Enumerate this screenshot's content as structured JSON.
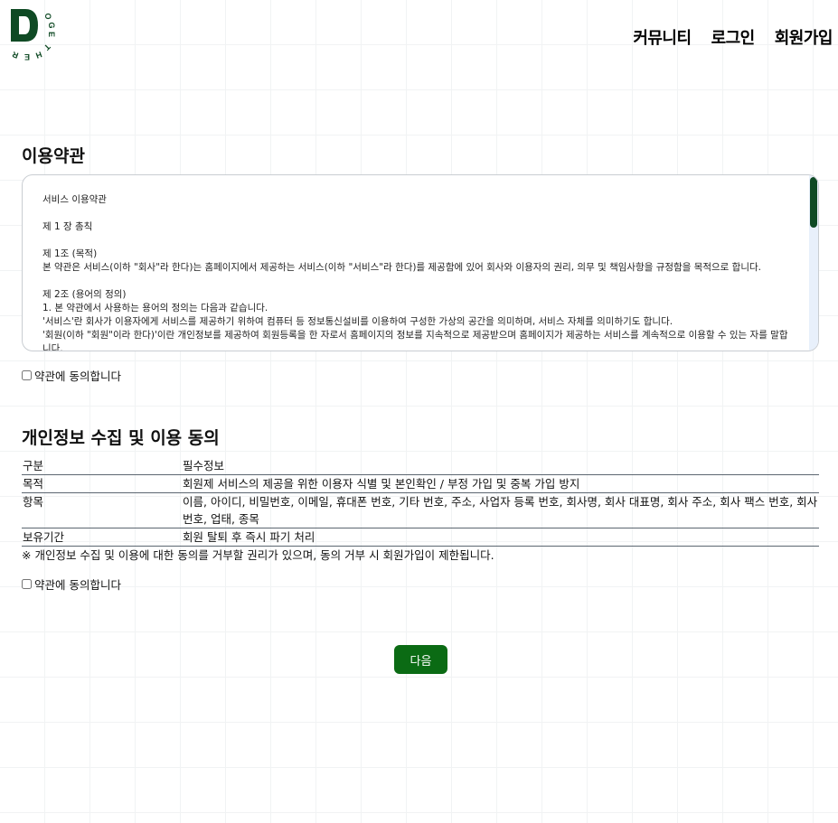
{
  "brand": {
    "letter": "D",
    "wordmark": "OGETHER",
    "color": "#0f4a24"
  },
  "nav": {
    "community": "커뮤니티",
    "login": "로그인",
    "signup": "회원가입"
  },
  "terms": {
    "title": "이용약관",
    "content": "서비스 이용약관\n\n제 1 장 총칙\n\n제 1조 (목적)\n본 약관은 서비스(이하 \"회사\"라 한다)는 홈페이지에서 제공하는 서비스(이하 \"서비스\"라 한다)를 제공함에 있어 회사와 이용자의 권리, 의무 및 책임사항을 규정함을 목적으로 합니다.\n\n제 2조 (용어의 정의)\n1. 본 약관에서 사용하는 용어의 정의는 다음과 같습니다.\n'서비스'란 회사가 이용자에게 서비스를 제공하기 위하여 컴퓨터 등 정보통신설비를 이용하여 구성한 가상의 공간을 의미하며, 서비스 자체를 의미하기도 합니다.\n'회원(이하 \"회원\"이라 한다)'이란 개인정보를 제공하여 회원등록을 한 자로서 홈페이지의 정보를 지속적으로 제공받으며 홈페이지가 제공하는 서비스를 계속적으로 이용할 수 있는 자를 말합니다.",
    "agree_label": "약관에 동의합니다"
  },
  "privacy": {
    "title": "개인정보 수집 및 이용 동의",
    "rows": [
      {
        "label": "구분",
        "value": "필수정보"
      },
      {
        "label": "목적",
        "value": "회원제 서비스의 제공을 위한 이용자 식별 및 본인확인 / 부정 가입 및 중복 가입 방지"
      },
      {
        "label": "항목",
        "value": "이름, 아이디, 비밀번호, 이메일, 휴대폰 번호, 기타 번호, 주소, 사업자 등록 번호, 회사명, 회사 대표명, 회사 주소, 회사 팩스 번호, 회사 번호, 업태, 종목"
      },
      {
        "label": "보유기간",
        "value": "회원 탈퇴 후 즉시 파기 처리"
      }
    ],
    "note": "※ 개인정보 수집 및 이용에 대한 동의를 거부할 권리가 있으며, 동의 거부 시 회원가입이 제한됩니다.",
    "agree_label": "약관에 동의합니다"
  },
  "next_button": "다음",
  "colors": {
    "accent": "#0b6b14",
    "scroll_thumb": "#0f4a24"
  }
}
